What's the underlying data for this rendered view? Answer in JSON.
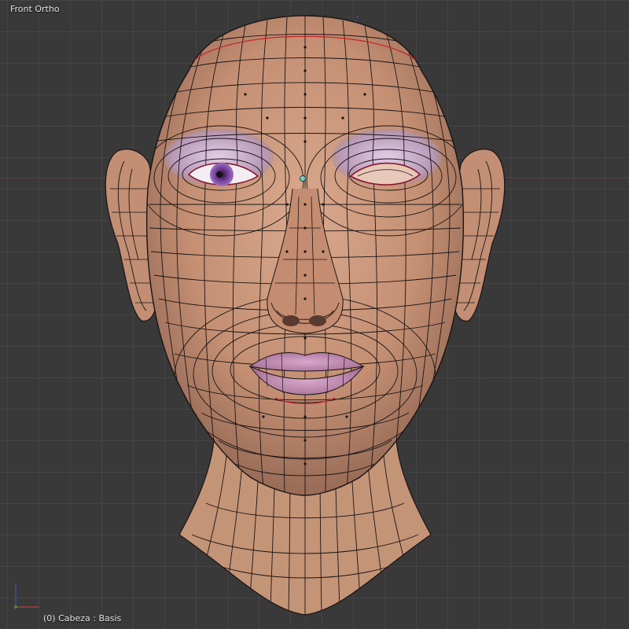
{
  "viewport": {
    "view_title": "Front Ortho",
    "object_info": "(0) Cabeza : Basis"
  },
  "scene": {
    "object_name": "Cabeza",
    "shape_key": "Basis",
    "view": "front-orthographic",
    "wireframe_color": "#1a1414",
    "skin_color": "#c9967a",
    "lip_color": "#c090b8",
    "eye_color": "#8a5ab0",
    "seam_color": "#c8202a",
    "grid_color": "#474747",
    "background_color": "#393939",
    "axis_x_color": "#a04040",
    "axis_y_color": "#5a8a2a",
    "axis_z_color": "#3a4aa0"
  }
}
